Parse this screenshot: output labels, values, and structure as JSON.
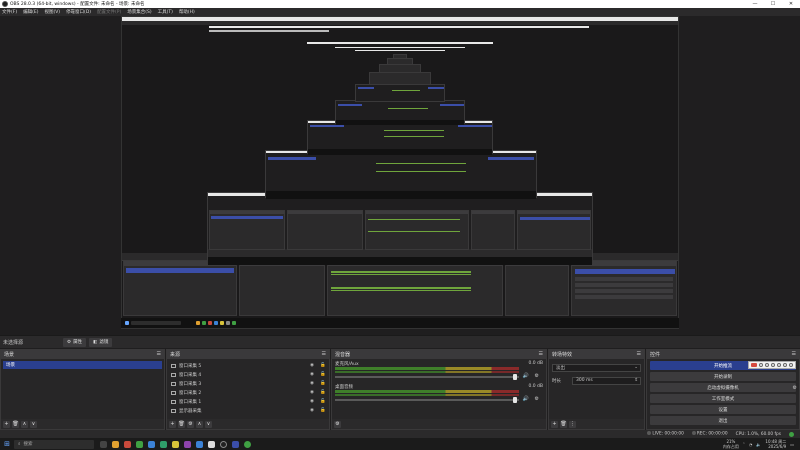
{
  "titlebar": {
    "title": "OBS 28.0.3 (64-bit, windows) - 配置文件: 未命名 - 场景: 未命名",
    "minimize": "—",
    "maximize": "☐",
    "close": "✕"
  },
  "menubar": {
    "items": [
      "文件(F)",
      "编辑(E)",
      "视图(V)",
      "停靠窗口(D)",
      "配置文件(P)",
      "场景集合(S)",
      "工具(T)",
      "帮助(H)"
    ]
  },
  "sourcebar": {
    "label": "未选择源",
    "properties": "属性",
    "filters": "滤镜"
  },
  "scenes": {
    "header": "场景",
    "items": [
      "场景"
    ]
  },
  "sources": {
    "header": "来源",
    "items": [
      "窗口采集 5",
      "窗口采集 4",
      "窗口采集 3",
      "窗口采集 2",
      "窗口采集 1",
      "显示器采集"
    ]
  },
  "mixer": {
    "header": "混音器",
    "tracks": [
      {
        "name": "麦克风/Aux",
        "db": "0.0 dB"
      },
      {
        "name": "桌面音频",
        "db": "0.0 dB"
      }
    ]
  },
  "transitions": {
    "header": "转场特效",
    "type": "淡出",
    "duration_label": "时长",
    "duration_value": "300 ms"
  },
  "controls": {
    "header": "控件",
    "buttons": [
      "开始推流",
      "开始录制",
      "启动虚拟摄像机",
      "工作室模式",
      "设置",
      "退出"
    ]
  },
  "statusbar": {
    "live": "LIVE: 00:00:00",
    "rec": "REC: 00:00:00",
    "cpu": "CPU: 1.0%, 60.00 fps"
  },
  "taskbar": {
    "search_placeholder": "搜索",
    "cpu_usage": "21%",
    "cpu_label": "内存占用",
    "time": "10:48 周二",
    "date": "2025/6/9"
  }
}
